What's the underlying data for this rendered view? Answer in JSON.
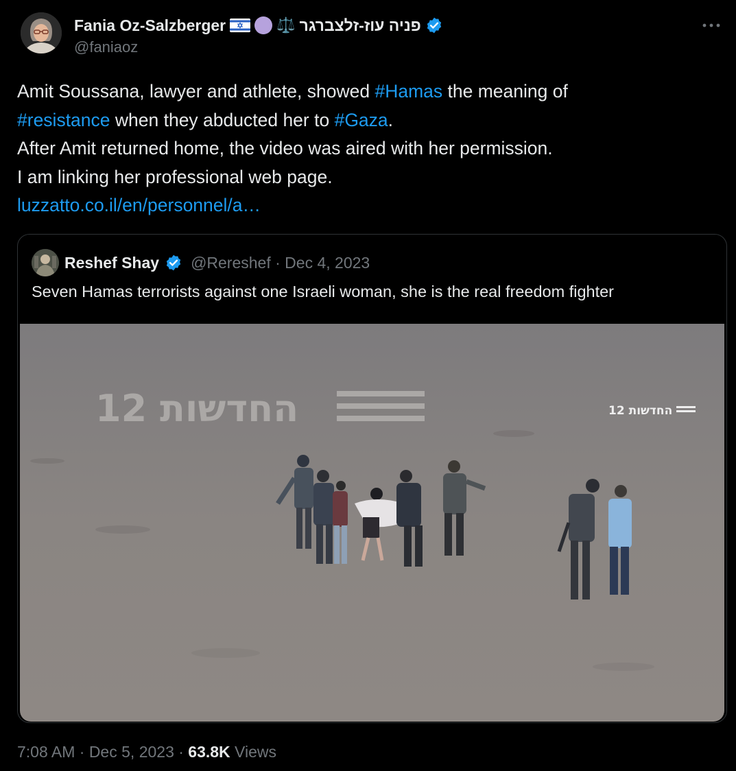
{
  "author": {
    "display_name": "Fania Oz-Salzberger",
    "hebrew_name": "פניה עוז-זלצברגר",
    "scales_glyph": "⚖️",
    "handle": "@faniaoz",
    "flag_icon": "israel-flag-icon",
    "circle_icon": "purple-circle-icon",
    "verified_icon": "verified-badge-icon"
  },
  "more_label": "···",
  "tweet": {
    "line1_pre": "Amit Soussana, lawyer and athlete, showed ",
    "hashtag_hamas": "#Hamas",
    "line1_post": " the meaning of",
    "hashtag_resistance": "#resistance",
    "line2_mid": " when they abducted her to ",
    "hashtag_gaza": "#Gaza",
    "line2_post": ".",
    "line3": "After Amit returned home, the video was aired with her permission.",
    "line4": "I am linking her professional web page.",
    "link": "luzzatto.co.il/en/personnel/a…"
  },
  "quote": {
    "name": "Reshef Shay",
    "meta": "@Rereshef · Dec 4, 2023",
    "text": "Seven Hamas terrorists against one Israeli woman, she is the real freedom fighter",
    "watermark_big": "12 החדשות",
    "watermark_small": "12 החדשות"
  },
  "footer": {
    "timestamp": "7:08 AM · Dec 5, 2023 · ",
    "views_count": "63.8K",
    "views_label": " Views"
  },
  "colors": {
    "background": "#000000",
    "text": "#e7e9ea",
    "secondary": "#71767b",
    "link": "#1d9bf0",
    "border": "#2f3336"
  }
}
